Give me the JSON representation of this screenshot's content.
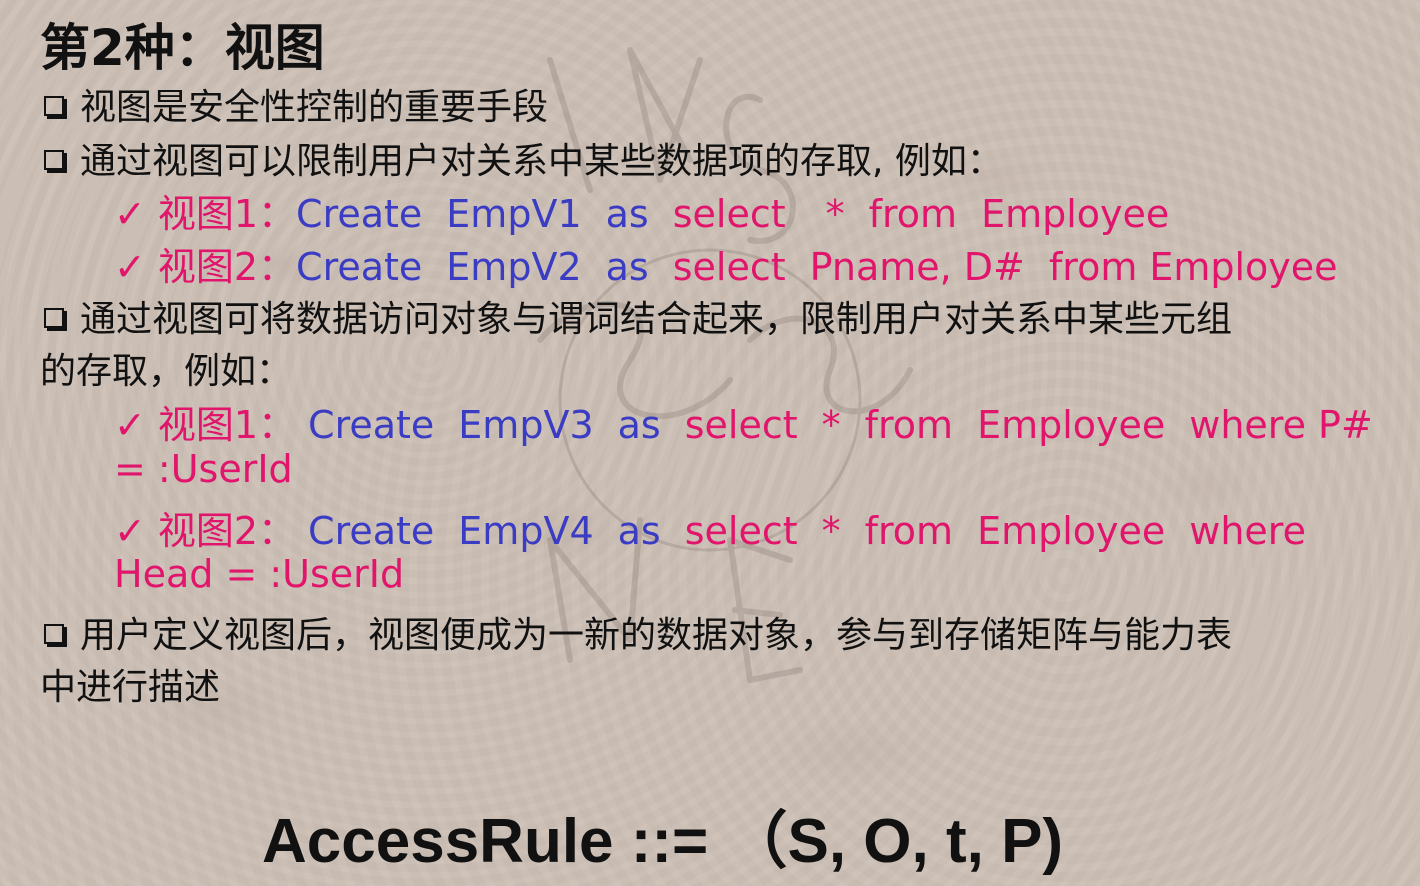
{
  "title": "第2种：视图",
  "bullets": {
    "b1": "视图是安全性控制的重要手段",
    "b2": "通过视图可以限制用户对关系中某些数据项的存取, 例如：",
    "b3_line1": "通过视图可将数据访问对象与谓词结合起来，限制用户对关系中某些元组",
    "b3_line2": "的存取，例如：",
    "b4_line1": "用户定义视图后，视图便成为一新的数据对象，参与到存储矩阵与能力表",
    "b4_line2": "中进行描述"
  },
  "examples1": [
    {
      "check": "✓",
      "label": "视图1：",
      "create": "Create",
      "name": "EmpV1",
      "as": "as",
      "select": "select",
      "cols": "*",
      "from": "from",
      "table": "Employee"
    },
    {
      "check": "✓",
      "label": "视图2：",
      "create": "Create",
      "name": "EmpV2",
      "as": "as",
      "select": "select",
      "cols": "Pname, D#",
      "from": "from",
      "table": "Employee"
    }
  ],
  "examples2": [
    {
      "check": "✓",
      "label": "视图1：",
      "create": "Create",
      "name": "EmpV3",
      "as": "as",
      "select": "select",
      "cols": "*",
      "from": "from",
      "table": "Employee",
      "where": "where P#",
      "cont": "= :UserId"
    },
    {
      "check": "✓",
      "label": "视图2：",
      "create": "Create",
      "name": "EmpV4",
      "as": "as",
      "select": "select",
      "cols": "*",
      "from": "from",
      "table": "Employee",
      "where": "where",
      "cont": "Head = :UserId"
    }
  ],
  "formula": "AccessRule ::=  （S, O,  t,  P)",
  "colors": {
    "pink": "#e0156b",
    "blue": "#3b3cc4",
    "text": "#111111"
  }
}
